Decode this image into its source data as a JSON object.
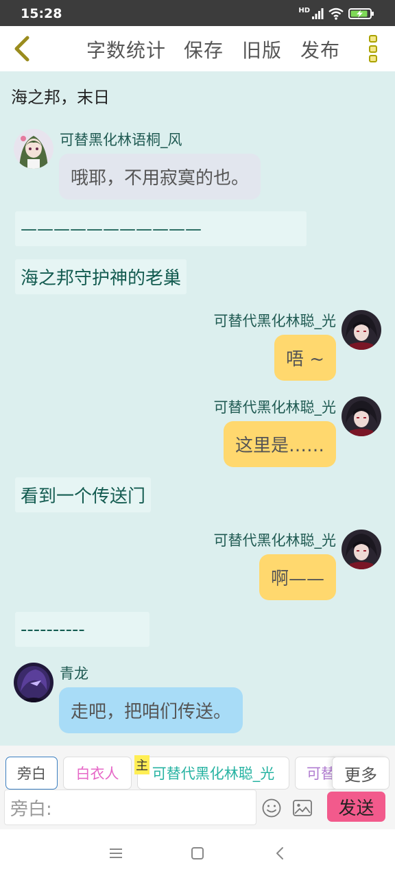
{
  "status_bar": {
    "time": "15:28",
    "network": "HD"
  },
  "nav": {
    "word_count": "字数统计",
    "save": "保存",
    "old_version": "旧版",
    "publish": "发布"
  },
  "title": "海之邦，末日",
  "messages": [
    {
      "type": "left",
      "sender": "可替黑化林语桐_风",
      "text": "哦耶，不用寂寞的也。",
      "color": "gray"
    },
    {
      "type": "narration",
      "text": "———————————"
    },
    {
      "type": "narration",
      "text": "海之邦守护神的老巢"
    },
    {
      "type": "right",
      "sender": "可替代黑化林聪_光",
      "text": "唔 ~",
      "color": "yellow"
    },
    {
      "type": "right",
      "sender": "可替代黑化林聪_光",
      "text": "这里是……",
      "color": "yellow"
    },
    {
      "type": "narration",
      "text": "看到一个传送门"
    },
    {
      "type": "right",
      "sender": "可替代黑化林聪_光",
      "text": "啊——",
      "color": "yellow"
    },
    {
      "type": "narration",
      "text": "----------"
    },
    {
      "type": "left",
      "sender": "青龙",
      "text": "走吧，把咱们传送。",
      "color": "blue"
    }
  ],
  "bottom": {
    "chips": [
      {
        "label": "旁白",
        "color": "#555555",
        "selected": true
      },
      {
        "label": "白衣人",
        "color": "#e667c7"
      },
      {
        "label": "可替代黑化林聪_光",
        "color": "#27b3a2",
        "tag": "主"
      },
      {
        "label": "可替",
        "color": "#b07cd0"
      }
    ],
    "more": "更多",
    "input_placeholder": "旁白:",
    "send": "发送"
  },
  "colors": {
    "background": "#dcefee",
    "bubble_gray": "#e2e6ee",
    "bubble_yellow": "#ffd86e",
    "bubble_blue": "#a8dcf7",
    "send_button": "#f25a8c"
  }
}
